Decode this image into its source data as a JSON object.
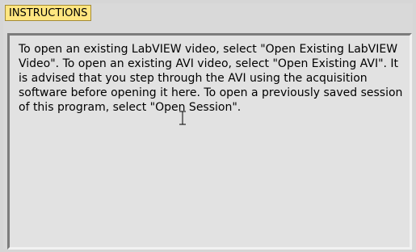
{
  "header": {
    "label": "INSTRUCTIONS"
  },
  "instructions": {
    "text": "To open an existing LabVIEW video, select \"Open Existing LabVIEW Video\". To open an existing AVI video, select \"Open Existing AVI\".  It is advised that you step through the AVI using the acquisition software before opening it here.  To open a previously saved session of this program, select \"Open Session\"."
  },
  "icons": {
    "cursor": "text-cursor-icon"
  }
}
